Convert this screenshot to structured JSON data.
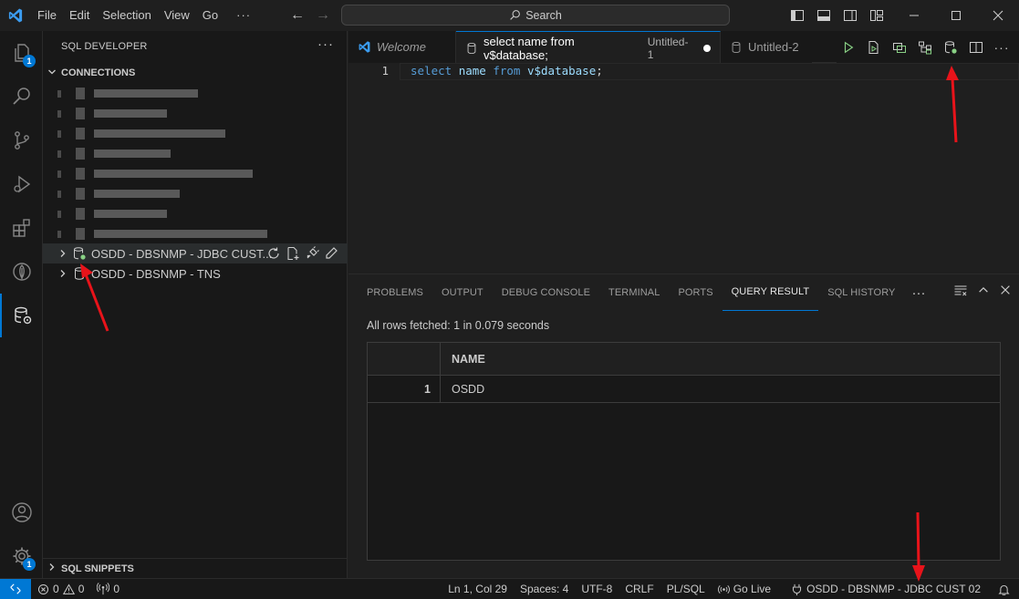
{
  "menu": [
    "File",
    "Edit",
    "Selection",
    "View",
    "Go"
  ],
  "menu_more": "···",
  "search": {
    "label": "Search"
  },
  "activity": {
    "explorer_badge": "1",
    "manage_badge": "1"
  },
  "sidebar": {
    "title": "SQL DEVELOPER",
    "more": "···",
    "connections_header": "CONNECTIONS",
    "connections": [
      {
        "label": "OSDD - DBSNMP - JDBC CUST...",
        "connected": true
      },
      {
        "label": "OSDD - DBSNMP - TNS",
        "connected": false
      }
    ],
    "snippets_header": "SQL SNIPPETS"
  },
  "tabs": [
    {
      "label": "Welcome",
      "sub": ""
    },
    {
      "label": "select name from v$database;",
      "sub": "Untitled-1"
    },
    {
      "label": "Untitled-2",
      "sub": ""
    }
  ],
  "editor": {
    "line_number": "1",
    "tokens": [
      {
        "t": "select",
        "c": "kw"
      },
      {
        "t": " ",
        "c": "pn"
      },
      {
        "t": "name",
        "c": "id"
      },
      {
        "t": " ",
        "c": "pn"
      },
      {
        "t": "from",
        "c": "kw"
      },
      {
        "t": " ",
        "c": "pn"
      },
      {
        "t": "v$database",
        "c": "id"
      },
      {
        "t": ";",
        "c": "pn"
      }
    ]
  },
  "panel": {
    "tabs": [
      "PROBLEMS",
      "OUTPUT",
      "DEBUG CONSOLE",
      "TERMINAL",
      "PORTS",
      "QUERY RESULT",
      "SQL HISTORY"
    ],
    "active_tab": "QUERY RESULT",
    "more": "···",
    "fetched": "All rows fetched: 1 in 0.079 seconds",
    "columns": [
      "NAME"
    ],
    "rows": [
      {
        "n": "1",
        "NAME": "OSDD"
      }
    ]
  },
  "status": {
    "errors": "0",
    "warnings": "0",
    "ports": "0",
    "position": "Ln 1, Col 29",
    "spaces": "Spaces: 4",
    "encoding": "UTF-8",
    "eol": "CRLF",
    "language": "PL/SQL",
    "golive": "Go Live",
    "connection": "OSDD - DBSNMP - JDBC CUST 02"
  },
  "colors": {
    "accent": "#0078d4",
    "annotation": "#e8131a",
    "connected": "#89d185"
  }
}
